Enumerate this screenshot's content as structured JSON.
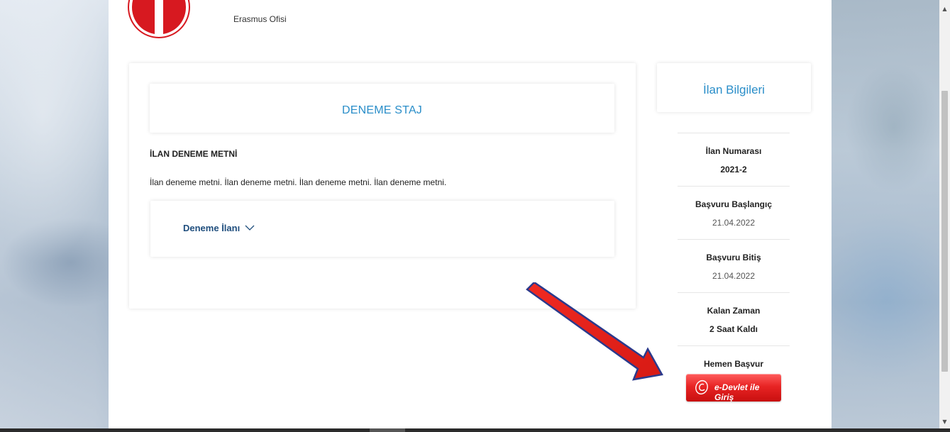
{
  "header": {
    "office_name": "Erasmus Ofisi"
  },
  "main": {
    "title": "DENEME STAJ",
    "heading": "İLAN DENEME METNİ",
    "body": "İlan deneme metni. İlan deneme metni. İlan deneme metni. İlan deneme metni.",
    "accordion_label": "Deneme İlanı"
  },
  "sidebar": {
    "title": "İlan Bilgileri",
    "items": [
      {
        "label": "İlan Numarası",
        "value": "2021-2"
      },
      {
        "label": "Başvuru Başlangıç",
        "value": "21.04.2022"
      },
      {
        "label": "Başvuru Bitiş",
        "value": "21.04.2022"
      },
      {
        "label": "Kalan Zaman",
        "value": "2 Saat Kaldı"
      }
    ],
    "apply_label": "Hemen Başvur",
    "edevlet_button": "e-Devlet ile Giriş"
  },
  "colors": {
    "accent_blue": "#2a8ec9",
    "dark_blue": "#1f4e7d",
    "edevlet_red": "#e82424",
    "annotation_arrow": "#e8231f"
  },
  "icons": {
    "logo": "university-logo",
    "accordion": "chevron-down-icon",
    "edevlet": "e-devlet-logo-icon",
    "annotation": "red-arrow-annotation"
  }
}
